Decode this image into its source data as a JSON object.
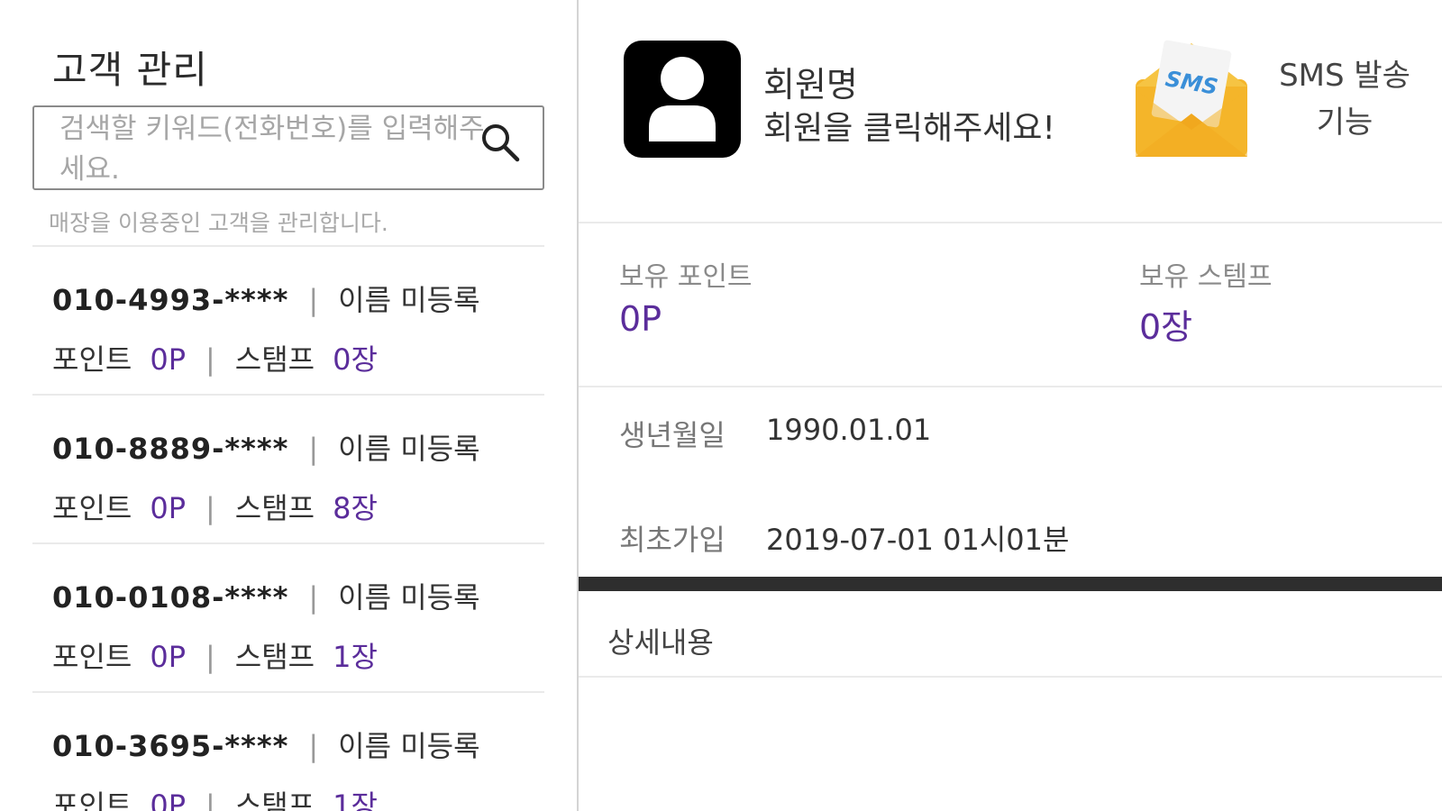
{
  "left": {
    "title": "고객 관리",
    "search": {
      "placeholder": "검색할 키워드(전화번호)를 입력해주세요.",
      "value": ""
    },
    "subtitle": "매장을 이용중인 고객을 관리합니다.",
    "point_label": "포인트",
    "stamp_label": "스탬프",
    "customers": [
      {
        "phone": "010-4993-****",
        "name": "이름 미등록",
        "points": "0P",
        "stamps": "0장"
      },
      {
        "phone": "010-8889-****",
        "name": "이름 미등록",
        "points": "0P",
        "stamps": "8장"
      },
      {
        "phone": "010-0108-****",
        "name": "이름 미등록",
        "points": "0P",
        "stamps": "1장"
      },
      {
        "phone": "010-3695-****",
        "name": "이름 미등록",
        "points": "0P",
        "stamps": "1장"
      }
    ]
  },
  "right": {
    "member_title": "회원명",
    "member_message": "회원을 클릭해주세요!",
    "sms_label": "SMS 발송 기능",
    "sms_envelope_text": "SMS",
    "points_label": "보유 포인트",
    "points_value": "0P",
    "stamps_label": "보유 스템프",
    "stamps_value": "0장",
    "birth_label": "생년월일",
    "birth_value": "1990.01.01",
    "join_label": "최초가입",
    "join_value": "2019-07-01 01시01분",
    "detail_label": "상세내용"
  },
  "colors": {
    "accent": "#5b2d9b",
    "divider": "#eaeaea",
    "bar": "#2e2e2e",
    "envelope": "#f5b92d"
  },
  "icons": {
    "search": "search-icon",
    "avatar": "user-avatar-icon",
    "sms": "sms-envelope-icon"
  }
}
